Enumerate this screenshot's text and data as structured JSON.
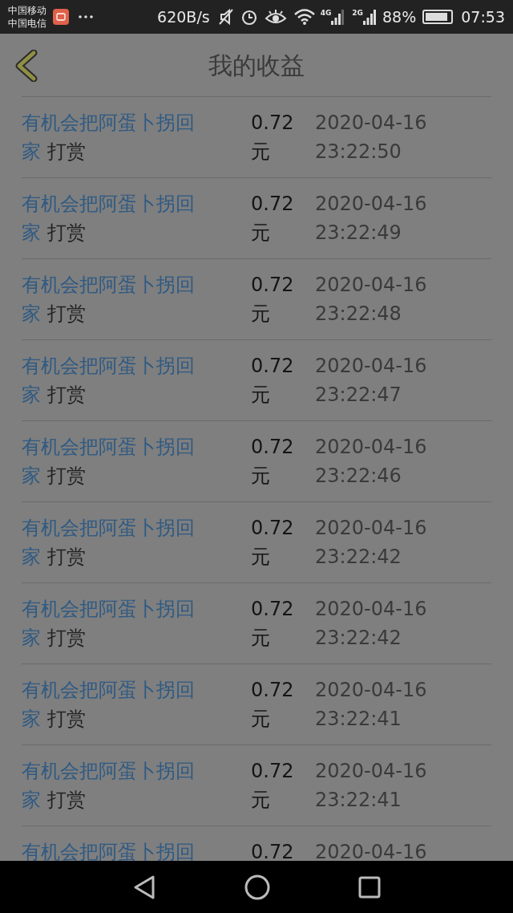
{
  "status_bar": {
    "carriers": [
      "中国移动",
      "中国电信"
    ],
    "speed": "620B/s",
    "network_1": "4G",
    "network_2": "2G",
    "battery": "88%",
    "time": "07:53"
  },
  "header": {
    "title": "我的收益"
  },
  "records": [
    {
      "name": "有机会把阿蛋卜拐回家",
      "action": "打赏",
      "amount": "0.72",
      "unit": "元",
      "date": "2020-04-16",
      "time": "23:22:50"
    },
    {
      "name": "有机会把阿蛋卜拐回家",
      "action": "打赏",
      "amount": "0.72",
      "unit": "元",
      "date": "2020-04-16",
      "time": "23:22:49"
    },
    {
      "name": "有机会把阿蛋卜拐回家",
      "action": "打赏",
      "amount": "0.72",
      "unit": "元",
      "date": "2020-04-16",
      "time": "23:22:48"
    },
    {
      "name": "有机会把阿蛋卜拐回家",
      "action": "打赏",
      "amount": "0.72",
      "unit": "元",
      "date": "2020-04-16",
      "time": "23:22:47"
    },
    {
      "name": "有机会把阿蛋卜拐回家",
      "action": "打赏",
      "amount": "0.72",
      "unit": "元",
      "date": "2020-04-16",
      "time": "23:22:46"
    },
    {
      "name": "有机会把阿蛋卜拐回家",
      "action": "打赏",
      "amount": "0.72",
      "unit": "元",
      "date": "2020-04-16",
      "time": "23:22:42"
    },
    {
      "name": "有机会把阿蛋卜拐回家",
      "action": "打赏",
      "amount": "0.72",
      "unit": "元",
      "date": "2020-04-16",
      "time": "23:22:42"
    },
    {
      "name": "有机会把阿蛋卜拐回家",
      "action": "打赏",
      "amount": "0.72",
      "unit": "元",
      "date": "2020-04-16",
      "time": "23:22:41"
    },
    {
      "name": "有机会把阿蛋卜拐回家",
      "action": "打赏",
      "amount": "0.72",
      "unit": "元",
      "date": "2020-04-16",
      "time": "23:22:41"
    },
    {
      "name": "有机会把阿蛋卜拐回",
      "amount": "0.72",
      "date": "2020-04-16"
    }
  ]
}
